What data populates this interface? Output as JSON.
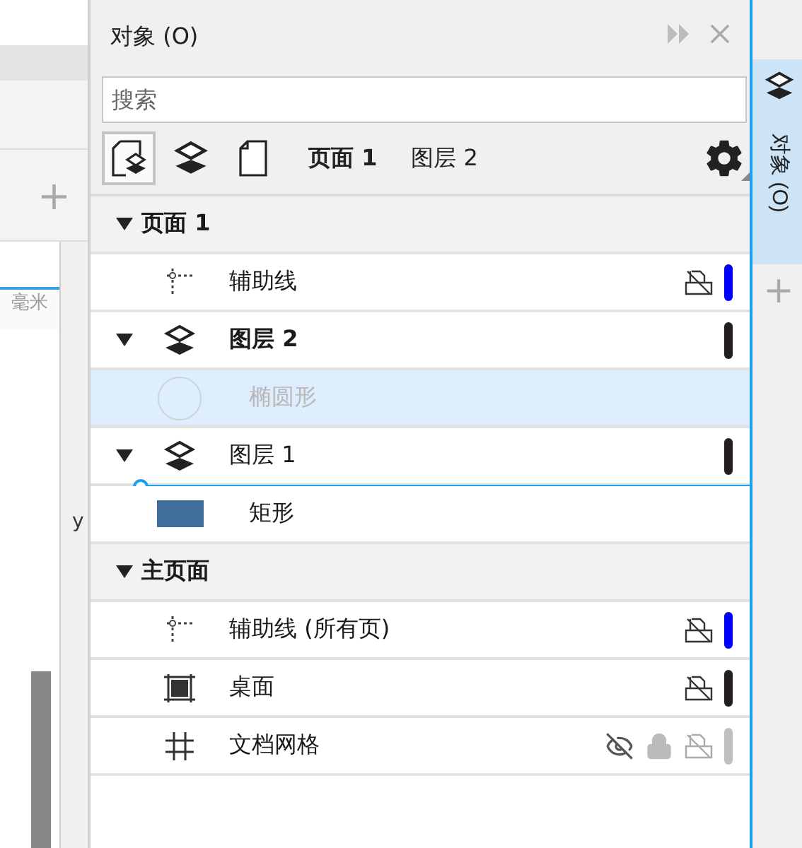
{
  "background_app": {
    "plus_label": "+",
    "ruler_unit": "毫米",
    "field_label": "y"
  },
  "panel": {
    "title": "对象 (O)",
    "search": {
      "placeholder": "搜索"
    },
    "toolbar": {
      "modes": [
        {
          "kind": "page-layer",
          "selected": true
        },
        {
          "kind": "layer",
          "selected": false
        },
        {
          "kind": "page",
          "selected": false
        }
      ],
      "current_page": "页面 1",
      "current_layer": "图层 2"
    },
    "tree": [
      {
        "kind": "page",
        "label": "页面 1",
        "expanded": true,
        "children": [
          {
            "kind": "guides",
            "label": "辅助线",
            "printable": false,
            "color": "#0000ff"
          },
          {
            "kind": "layer",
            "label": "图层 2",
            "active": true,
            "expanded": true,
            "drop_target": false,
            "color": "#231f20",
            "children": [
              {
                "kind": "ellipse",
                "label": "椭圆形",
                "selected": true,
                "dimmed": true
              }
            ]
          },
          {
            "kind": "layer",
            "label": "图层 1",
            "active": false,
            "expanded": true,
            "drop_target": true,
            "color": "#231f20",
            "children": [
              {
                "kind": "rectangle",
                "label": "矩形",
                "selected": false,
                "dimmed": false
              }
            ]
          }
        ]
      },
      {
        "kind": "page",
        "label": "主页面",
        "expanded": true,
        "children": [
          {
            "kind": "guides",
            "label": "辅助线 (所有页)",
            "printable": false,
            "color": "#0000ff"
          },
          {
            "kind": "desktop",
            "label": "桌面",
            "printable": false,
            "color": "#231f20"
          },
          {
            "kind": "grid",
            "label": "文档网格",
            "visible": false,
            "locked": true,
            "printable": false,
            "color": "#c0c0c0"
          }
        ]
      }
    ]
  },
  "side_tabs": [
    {
      "label": "对象 (O)",
      "selected": true
    }
  ]
}
